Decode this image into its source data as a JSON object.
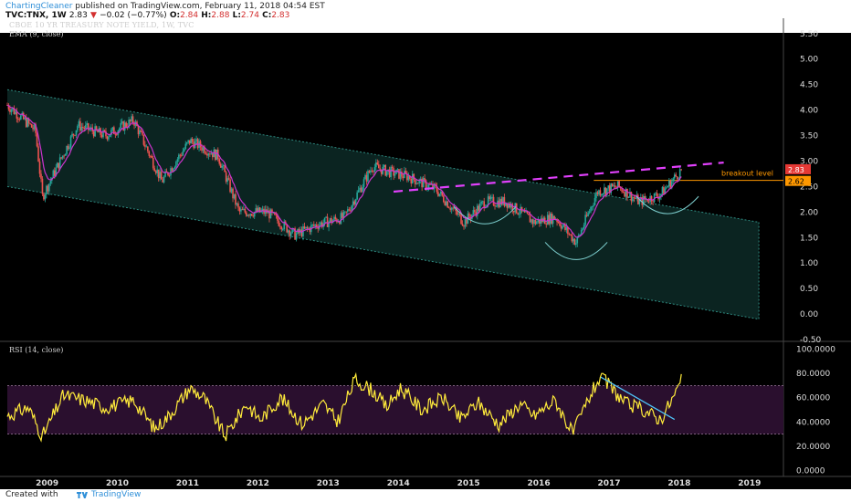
{
  "header": {
    "author": "ChartingCleaner",
    "published_text": " published on TradingView.com, February 11, 2018 04:54 EST",
    "symbol": "TVC:TNX, 1W",
    "last": "2.83",
    "down_arrow": "▼",
    "change": "−0.02 (−0.77%)",
    "o_label": "O:",
    "o": "2.84",
    "h_label": "H:",
    "h": "2.88",
    "l_label": "L:",
    "l": "2.74",
    "c_label": "C:",
    "c": "2.83"
  },
  "legend": {
    "title": "CBOE 10 YR TREASURY NOTE YIELD, 1W, TVC",
    "ema": "EMA (9, close)",
    "rsi": "RSI (14, close)"
  },
  "footer": {
    "created": "Created with",
    "brand": "TradingView"
  },
  "colors": {
    "background": "#000000",
    "up_candle": "#26a69a",
    "down_candle": "#ef5350",
    "ema": "#cc33cc",
    "channel_fill": "#0d2a27",
    "channel_line": "#2e8a80",
    "dashed_line": "#e040fb",
    "breakout": "#ff9800",
    "rsi_line": "#ffeb3b",
    "rsi_band": "#2a0f2e",
    "trendline": "#4fc3f7",
    "price_label": "#e53935"
  },
  "chart_data": [
    {
      "type": "candlestick",
      "title": "CBOE 10 YR TREASURY NOTE YIELD, 1W, TVC",
      "x_ticks": [
        "2009",
        "2010",
        "2011",
        "2012",
        "2013",
        "2014",
        "2015",
        "2016",
        "2017",
        "2018",
        "2019"
      ],
      "y_ticks": [
        "5.50",
        "5.00",
        "4.50",
        "4.00",
        "3.50",
        "3.00",
        "2.50",
        "2.00",
        "1.50",
        "1.00",
        "0.50",
        "0.00",
        "-0.50"
      ],
      "ylim": [
        -0.5,
        5.8
      ],
      "series": [
        {
          "name": "Price",
          "x": [
            2008.5,
            2008.9,
            2009.0,
            2009.5,
            2009.9,
            2010.3,
            2010.7,
            2011.1,
            2011.5,
            2011.8,
            2012.2,
            2012.6,
            2012.9,
            2013.3,
            2013.7,
            2013.9,
            2014.2,
            2014.6,
            2015.0,
            2015.3,
            2015.6,
            2016.0,
            2016.3,
            2016.6,
            2016.9,
            2017.2,
            2017.5,
            2017.8,
            2018.1
          ],
          "values": [
            4.1,
            3.6,
            2.3,
            3.7,
            3.5,
            3.8,
            2.6,
            3.4,
            3.1,
            2.0,
            2.0,
            1.55,
            1.75,
            1.9,
            2.9,
            2.8,
            2.7,
            2.45,
            1.8,
            2.2,
            2.2,
            1.8,
            1.9,
            1.4,
            2.4,
            2.5,
            2.2,
            2.35,
            2.83
          ]
        },
        {
          "name": "EMA (9, close)",
          "smoothing": "ema9"
        }
      ],
      "annotations": {
        "breakout_level": {
          "label": "breakout level",
          "value": 2.62
        },
        "last_price_label": "2.83",
        "breakout_price_label": "2.62",
        "channel": {
          "upper_start": 4.4,
          "upper_end": 1.8,
          "lower_start": 2.5,
          "lower_end": -0.1,
          "x_start": 2008.5,
          "x_end": 2019.2
        },
        "dashed_resistance": {
          "start": [
            2014.0,
            2.4
          ],
          "end": [
            2018.7,
            2.97
          ]
        },
        "arcs": [
          {
            "center_x": 2015.3,
            "bottom": 1.75
          },
          {
            "center_x": 2016.6,
            "bottom": 1.05
          },
          {
            "center_x": 2017.9,
            "bottom": 1.95
          }
        ]
      }
    },
    {
      "type": "line",
      "title": "RSI (14, close)",
      "y_ticks": [
        "100.0000",
        "80.0000",
        "60.0000",
        "40.0000",
        "20.0000",
        "0.0000"
      ],
      "ylim": [
        -5,
        105
      ],
      "bands": [
        30,
        70
      ],
      "series": [
        {
          "name": "RSI",
          "x": [
            2008.5,
            2008.8,
            2009.0,
            2009.3,
            2009.6,
            2009.9,
            2010.3,
            2010.6,
            2010.8,
            2011.1,
            2011.3,
            2011.6,
            2011.9,
            2012.1,
            2012.4,
            2012.7,
            2013.0,
            2013.2,
            2013.45,
            2013.7,
            2013.9,
            2014.1,
            2014.4,
            2014.7,
            2014.95,
            2015.2,
            2015.5,
            2015.8,
            2016.0,
            2016.3,
            2016.55,
            2016.8,
            2016.95,
            2017.1,
            2017.3,
            2017.55,
            2017.8,
            2018.0,
            2018.1
          ],
          "values": [
            45,
            52,
            28,
            62,
            58,
            52,
            58,
            34,
            45,
            68,
            60,
            28,
            55,
            42,
            60,
            38,
            55,
            40,
            75,
            66,
            52,
            68,
            50,
            60,
            42,
            56,
            38,
            55,
            45,
            58,
            30,
            62,
            78,
            68,
            55,
            50,
            42,
            62,
            74
          ]
        }
      ],
      "trendline": {
        "start": [
          2016.95,
          77
        ],
        "end": [
          2018.0,
          42
        ]
      }
    }
  ]
}
